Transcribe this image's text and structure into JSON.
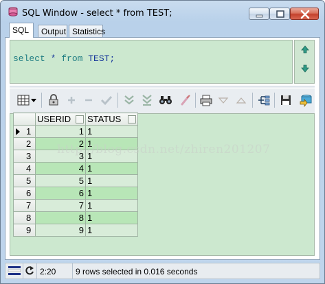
{
  "window": {
    "title": "SQL Window - select * from TEST;"
  },
  "tabs": [
    "SQL",
    "Output",
    "Statistics"
  ],
  "active_tab": "SQL",
  "editor": {
    "keyword_select": "select",
    "star": " * ",
    "keyword_from": "from",
    "table": " TEST;"
  },
  "grid": {
    "columns": [
      "USERID",
      "STATUS"
    ],
    "rows": [
      {
        "n": "1",
        "userid": "1",
        "status": "1"
      },
      {
        "n": "2",
        "userid": "2",
        "status": "1"
      },
      {
        "n": "3",
        "userid": "3",
        "status": "1"
      },
      {
        "n": "4",
        "userid": "4",
        "status": "1"
      },
      {
        "n": "5",
        "userid": "5",
        "status": "1"
      },
      {
        "n": "6",
        "userid": "6",
        "status": "1"
      },
      {
        "n": "7",
        "userid": "7",
        "status": "1"
      },
      {
        "n": "8",
        "userid": "8",
        "status": "1"
      },
      {
        "n": "9",
        "userid": "9",
        "status": "1"
      }
    ],
    "current_row": 1
  },
  "watermark": "http://blog.csdn.net/zhiren201207",
  "status": {
    "cursor_position": "2:20",
    "message": "9 rows selected in 0.016 seconds"
  },
  "colors": {
    "editor_bg": "#cce8cf",
    "row_even": "#b8e6b7",
    "row_odd": "#d8ecd9"
  },
  "toolbar_icons": [
    "grid-layout-icon",
    "dropdown-arrow-icon",
    "lock-icon",
    "add-record-icon",
    "delete-record-icon",
    "post-changes-icon",
    "next-page-icon",
    "last-page-icon",
    "find-binoculars-icon",
    "clear-filter-icon",
    "print-icon",
    "sort-desc-icon",
    "sort-asc-icon",
    "export-icon",
    "save-icon",
    "query-icon"
  ]
}
